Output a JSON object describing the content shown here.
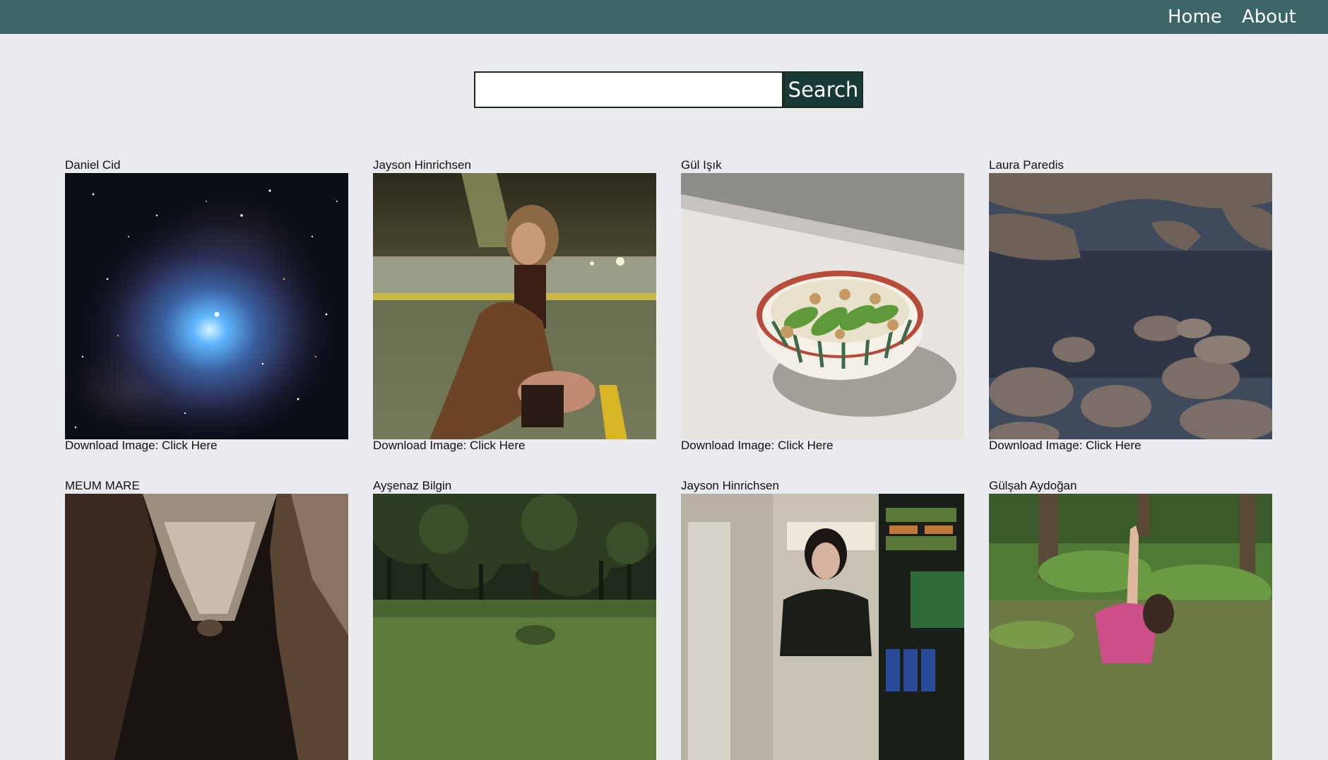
{
  "nav": {
    "home": "Home",
    "about": "About",
    "bar_color": "#3c6666"
  },
  "search": {
    "value": "",
    "placeholder": "",
    "button_label": "Search",
    "button_color": "#173a36"
  },
  "cards": [
    {
      "author": "Daniel Cid",
      "download_prefix": "Download Image: ",
      "download_link": "Click Here",
      "photo": "iris-nebula-photo"
    },
    {
      "author": "Jayson Hinrichsen",
      "download_prefix": "Download Image: ",
      "download_link": "Click Here",
      "photo": "woman-in-parking-garage-photo"
    },
    {
      "author": "Gül Işık",
      "download_prefix": "Download Image: ",
      "download_link": "Click Here",
      "photo": "avocado-walnut-bowl-photo"
    },
    {
      "author": "Laura Paredis",
      "download_prefix": "Download Image: ",
      "download_link": "Click Here",
      "photo": "rocky-shore-photo"
    },
    {
      "author": "MEUM MARE",
      "download_prefix": "",
      "download_link": "",
      "photo": "canyon-cave-photo"
    },
    {
      "author": "Ayşenaz Bilgin",
      "download_prefix": "",
      "download_link": "",
      "photo": "tree-in-park-photo"
    },
    {
      "author": "Jayson Hinrichsen",
      "download_prefix": "",
      "download_link": "",
      "photo": "woman-in-store-photo"
    },
    {
      "author": "Gülşah Aydoğan",
      "download_prefix": "",
      "download_link": "",
      "photo": "woman-in-forest-photo"
    }
  ]
}
